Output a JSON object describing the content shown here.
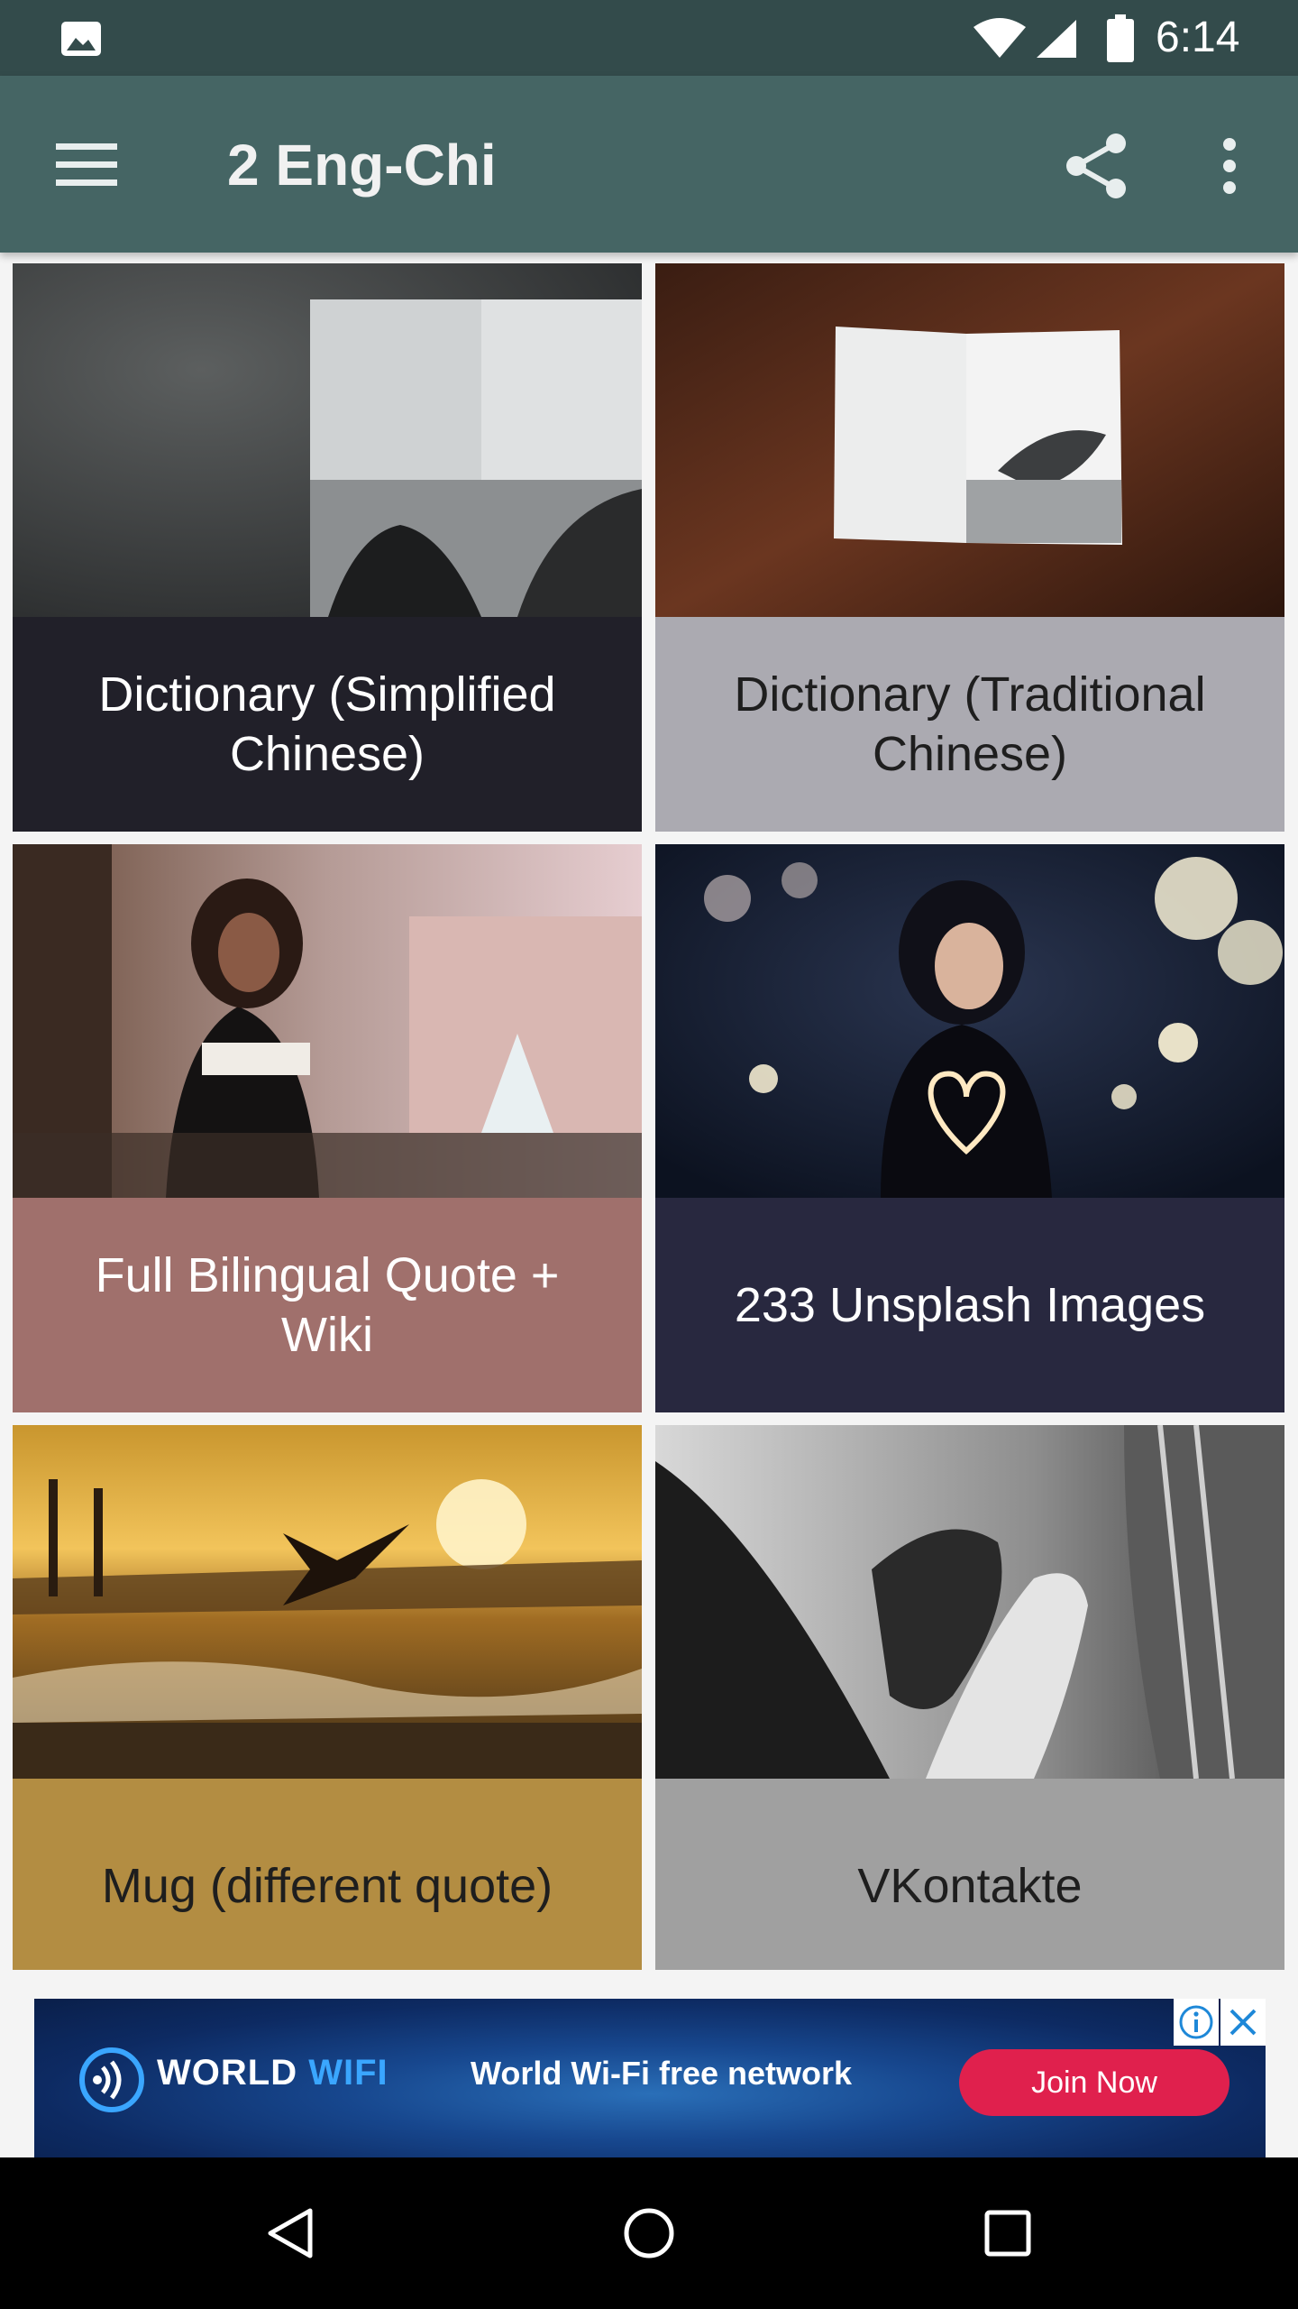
{
  "status_bar": {
    "time": "6:14",
    "icons": [
      "photo-icon",
      "wifi-icon",
      "cell-signal-icon",
      "battery-icon"
    ]
  },
  "app_bar": {
    "title": "2 Eng-Chi",
    "icons": [
      "menu-icon",
      "share-icon",
      "more-vert-icon"
    ]
  },
  "cards": [
    {
      "label": "Dictionary (Simplified Chinese)",
      "image": "open book photo on dark stone",
      "caption_bg": "#212029",
      "caption_color": "#ffffff"
    },
    {
      "label": "Dictionary (Traditional Chinese)",
      "image": "open book photo on wooden table",
      "caption_bg": "#abaab1",
      "caption_color": "#1e1e1e"
    },
    {
      "label": "Full Bilingual Quote + Wiki",
      "image": "woman reading on balcony",
      "caption_bg": "#a0706c",
      "caption_color": "#ffffff"
    },
    {
      "label": "233 Unsplash Images",
      "image": "woman holding heart-shaped lights",
      "caption_bg": "#28283f",
      "caption_color": "#ffffff"
    },
    {
      "label": "Mug (different quote)",
      "image": "dancer leaping at sunset beach",
      "caption_bg": "#b38d42",
      "caption_color": "#1e1e1e"
    },
    {
      "label": "VKontakte",
      "image": "black and white hands clasped",
      "caption_bg": "#a0a0a0",
      "caption_color": "#1e1e1e"
    }
  ],
  "ad": {
    "brand_white": "WORLD",
    "brand_blue": "WIFI",
    "tagline": "World Wi-Fi free network",
    "cta": "Join Now",
    "icons": [
      "ad-info-icon",
      "ad-close-icon"
    ],
    "colors": {
      "cta_bg": "#e0204d",
      "brand_accent": "#3aa6ff"
    }
  },
  "nav_bar": {
    "icons": [
      "back-icon",
      "home-icon",
      "recents-icon"
    ]
  },
  "colors": {
    "status_bar": "#334b4b",
    "app_bar": "#456564"
  }
}
